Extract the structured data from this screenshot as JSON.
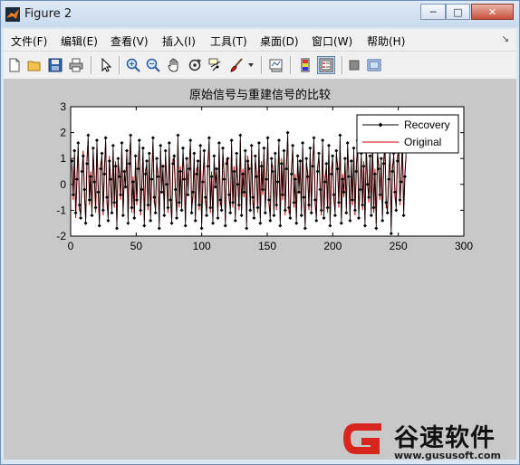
{
  "window": {
    "title": "Figure 2"
  },
  "menu": [
    "文件(F)",
    "编辑(E)",
    "查看(V)",
    "插入(I)",
    "工具(T)",
    "桌面(D)",
    "窗口(W)",
    "帮助(H)"
  ],
  "toolbar": [
    "new-figure",
    "open-file",
    "save",
    "print",
    "edit-plot",
    "zoom-in",
    "zoom-out",
    "pan",
    "rotate-3d",
    "data-cursor",
    "brush",
    "brush-dropdown",
    "link-plot",
    "insert-colorbar",
    "insert-legend",
    "hide-plot-tools",
    "show-plot-tools"
  ],
  "chart_data": {
    "type": "line",
    "title": "原始信号与重建信号的比较",
    "xlim": [
      0,
      300
    ],
    "ylim": [
      -2,
      3
    ],
    "xticks": [
      0,
      50,
      100,
      150,
      200,
      250,
      300
    ],
    "yticks": [
      -2,
      -1,
      0,
      1,
      2,
      3
    ],
    "legend_position": "top-right",
    "series": [
      {
        "name": "Recovery",
        "color": "#000000",
        "marker": "diamond",
        "values": [
          0.9,
          -0.4,
          1.3,
          -1.1,
          0.2,
          1.6,
          -0.8,
          -1.3,
          0.5,
          1.1,
          -0.2,
          -1.5,
          0.8,
          1.9,
          -0.6,
          0.3,
          -1.2,
          1.4,
          0.1,
          -0.9,
          1.7,
          -0.3,
          -1.6,
          0.6,
          1.2,
          -1.0,
          0.4,
          1.8,
          -0.5,
          -1.4,
          0.9,
          0.2,
          -1.1,
          1.5,
          -0.7,
          0.7,
          -1.7,
          1.0,
          0.3,
          -0.4,
          1.6,
          -1.2,
          0.5,
          -0.1,
          1.3,
          -1.5,
          0.8,
          1.9,
          -0.9,
          0.1,
          -1.3,
          1.1,
          -0.6,
          0.6,
          1.7,
          -1.0,
          -0.2,
          1.4,
          -1.6,
          0.4,
          0.9,
          -0.8,
          1.2,
          -1.4,
          0.2,
          1.8,
          -0.5,
          -1.1,
          1.0,
          0.3,
          -1.7,
          1.5,
          -0.3,
          0.7,
          -1.2,
          1.3,
          0.0,
          -0.9,
          1.6,
          -0.6,
          -1.5,
          0.8,
          1.1,
          -0.2,
          -1.3,
          1.9,
          -0.7,
          0.5,
          -1.0,
          1.4,
          0.2,
          -1.6,
          1.0,
          -0.4,
          0.6,
          1.7,
          -1.1,
          -0.3,
          1.2,
          -1.4,
          0.4,
          0.9,
          -0.8,
          1.5,
          -1.7,
          0.1,
          1.3,
          -0.5,
          -1.2,
          0.7,
          1.8,
          -0.9,
          0.3,
          -1.5,
          1.1,
          -0.1,
          0.6,
          -1.3,
          1.6,
          -0.6,
          -1.0,
          1.4,
          0.2,
          -1.6,
          0.8,
          1.0,
          -0.4,
          -1.1,
          1.7,
          -0.7,
          0.5,
          -1.4,
          1.2,
          0.0,
          -0.8,
          1.9,
          -1.2,
          0.4,
          -0.3,
          1.3,
          -1.7,
          0.9,
          0.6,
          -1.0,
          1.5,
          -0.5,
          -1.3,
          1.1,
          0.3,
          -0.9,
          1.6,
          -1.5,
          0.7,
          -0.2,
          1.4,
          -1.1,
          0.2,
          1.8,
          -0.6,
          -1.4,
          1.0,
          0.5,
          -1.2,
          1.2,
          -0.8,
          0.1,
          1.7,
          -1.6,
          0.8,
          -0.4,
          1.3,
          -1.0,
          0.6,
          2.0,
          -0.9,
          -1.3,
          0.4,
          1.5,
          -0.7,
          0.2,
          -1.5,
          1.1,
          -0.3,
          0.9,
          -1.2,
          1.6,
          -0.5,
          -1.7,
          1.0,
          0.3,
          -0.8,
          1.4,
          -1.1,
          0.7,
          1.8,
          -0.6,
          -1.4,
          0.5,
          1.2,
          -0.2,
          -1.0,
          1.7,
          -1.3,
          0.1,
          0.8,
          -0.9,
          1.5,
          -1.6,
          0.4,
          1.1,
          -0.4,
          -1.2,
          1.3,
          0.6,
          -0.7,
          1.9,
          -1.5,
          0.2,
          -0.3,
          1.0,
          -1.1,
          1.6,
          0.3,
          -1.4,
          0.9,
          -0.6,
          1.4,
          -1.0,
          0.5,
          1.7,
          -1.3,
          -0.2,
          1.2,
          -0.8,
          0.7,
          -1.6,
          1.5,
          0.0,
          -0.5,
          1.1,
          -1.2,
          1.8,
          -0.9,
          0.4,
          -1.7,
          1.3,
          0.6,
          -0.4,
          1.0,
          -1.4,
          0.8,
          1.6,
          -0.7,
          -1.1,
          0.2,
          1.4,
          -1.9,
          0.5,
          1.2,
          -0.3,
          -1.0,
          0.9,
          1.5,
          -0.6,
          0.1,
          1.7,
          -1.2,
          0.3,
          1.3
        ]
      },
      {
        "name": "Original",
        "color": "#cc0000",
        "marker": "none",
        "values": [
          0.7,
          -0.6,
          1.1,
          -1.3,
          0.4,
          1.4,
          -1.0,
          -1.1,
          0.3,
          1.3,
          -0.4,
          -1.3,
          1.0,
          1.7,
          -0.8,
          0.5,
          -1.0,
          1.2,
          0.3,
          -1.1,
          1.5,
          -0.1,
          -1.4,
          0.8,
          1.0,
          -1.2,
          0.6,
          1.6,
          -0.7,
          -1.2,
          1.1,
          0.0,
          -0.9,
          1.3,
          -0.9,
          0.9,
          -1.5,
          0.8,
          0.5,
          -0.6,
          1.4,
          -1.0,
          0.3,
          0.1,
          1.1,
          -1.3,
          1.0,
          1.7,
          -1.1,
          0.3,
          -1.1,
          0.9,
          -0.8,
          0.8,
          1.5,
          -1.2,
          0.0,
          1.2,
          -1.4,
          0.6,
          0.7,
          -1.0,
          1.0,
          -1.2,
          0.4,
          1.6,
          -0.7,
          -0.9,
          0.8,
          0.5,
          -1.5,
          1.3,
          -0.1,
          0.5,
          -1.0,
          1.1,
          0.2,
          -1.1,
          1.4,
          -0.4,
          -1.3,
          1.0,
          0.9,
          -0.4,
          -1.1,
          1.7,
          -0.9,
          0.7,
          -0.8,
          1.2,
          0.4,
          -1.4,
          0.8,
          -0.2,
          0.8,
          1.5,
          -0.9,
          -0.5,
          1.0,
          -1.2,
          0.6,
          0.7,
          -1.0,
          1.3,
          -1.5,
          0.3,
          1.1,
          -0.7,
          -1.0,
          0.9,
          1.6,
          -1.1,
          0.5,
          -1.3,
          0.9,
          0.1,
          0.4,
          -1.1,
          1.4,
          -0.8,
          -0.8,
          1.2,
          0.4,
          -1.4,
          1.0,
          0.8,
          -0.6,
          -0.9,
          1.5,
          -0.9,
          0.7,
          -1.2,
          1.0,
          0.2,
          -1.0,
          1.7,
          -1.0,
          0.6,
          -0.5,
          1.1,
          -1.5,
          1.1,
          0.4,
          -0.8,
          1.3,
          -0.7,
          -1.1,
          0.9,
          0.5,
          -1.1,
          1.4,
          -1.3,
          0.9,
          -0.4,
          1.2,
          -0.9,
          0.4,
          1.6,
          -0.8,
          -1.2,
          0.8,
          0.7,
          -1.0,
          1.0,
          -1.0,
          0.3,
          1.5,
          -1.4,
          1.0,
          -0.6,
          1.1,
          -1.2,
          0.8,
          1.8,
          -1.1,
          -1.1,
          0.6,
          1.3,
          -0.9,
          0.4,
          -1.3,
          0.9,
          -0.1,
          0.7,
          -1.0,
          1.4,
          -0.7,
          -1.5,
          0.8,
          0.5,
          -1.0,
          1.2,
          -0.9,
          0.9,
          1.6,
          -0.8,
          -1.2,
          0.7,
          1.0,
          0.0,
          -1.2,
          1.5,
          -1.1,
          0.3,
          0.6,
          -1.1,
          1.3,
          -1.4,
          0.6,
          0.9,
          -0.6,
          -1.0,
          1.1,
          0.8,
          -0.9,
          1.7,
          -1.3,
          0.4,
          -0.5,
          0.8,
          -0.9,
          1.4,
          0.5,
          -1.2,
          0.7,
          -0.8,
          1.2,
          -1.2,
          0.7,
          1.5,
          -1.1,
          0.0,
          1.0,
          -1.0,
          0.9,
          -1.4,
          1.3,
          0.2,
          -0.7,
          0.9,
          -1.0,
          1.6,
          -1.1,
          0.6,
          -1.5,
          1.1,
          0.8,
          -0.6,
          0.8,
          -1.2,
          1.0,
          1.4,
          -0.9,
          -0.9,
          0.4,
          1.2,
          -1.7,
          0.7,
          1.0,
          -0.5,
          -0.8,
          1.1,
          1.3,
          -0.8,
          0.3,
          1.5,
          -1.0,
          0.5,
          1.1
        ]
      }
    ]
  },
  "watermark": {
    "name": "谷速软件",
    "url": "www.gususoft.com"
  }
}
